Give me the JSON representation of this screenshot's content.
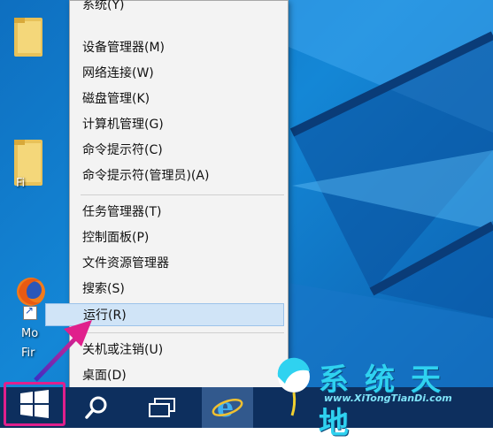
{
  "context_menu": {
    "items": [
      {
        "label": "系统(Y)"
      },
      {
        "label": "设备管理器(M)"
      },
      {
        "label": "网络连接(W)"
      },
      {
        "label": "磁盘管理(K)"
      },
      {
        "label": "计算机管理(G)"
      },
      {
        "label": "命令提示符(C)"
      },
      {
        "label": "命令提示符(管理员)(A)"
      },
      {
        "label": "任务管理器(T)"
      },
      {
        "label": "控制面板(P)"
      },
      {
        "label": "文件资源管理器"
      },
      {
        "label": "搜索(S)"
      },
      {
        "label": "运行(R)"
      },
      {
        "label": "关机或注销(U)"
      },
      {
        "label": "桌面(D)"
      }
    ],
    "highlighted_item": "运行(R)"
  },
  "desktop": {
    "labels": [
      "Fi",
      "Mo",
      "Fir"
    ]
  },
  "watermark": {
    "title": "系统天地",
    "url": "www.XiTongTianDi.com"
  },
  "colors": {
    "desktop_bg": "#1487d6",
    "taskbar_bg": "#0d2f5e",
    "highlight_bg": "#d0e4f7",
    "start_outline": "#e0208c",
    "arrow": "#4a3fd8"
  },
  "icons": [
    "folder-icon",
    "firefox-icon",
    "windows-logo-icon",
    "search-icon",
    "task-view-icon",
    "ie-icon",
    "watermark-logo-icon"
  ]
}
